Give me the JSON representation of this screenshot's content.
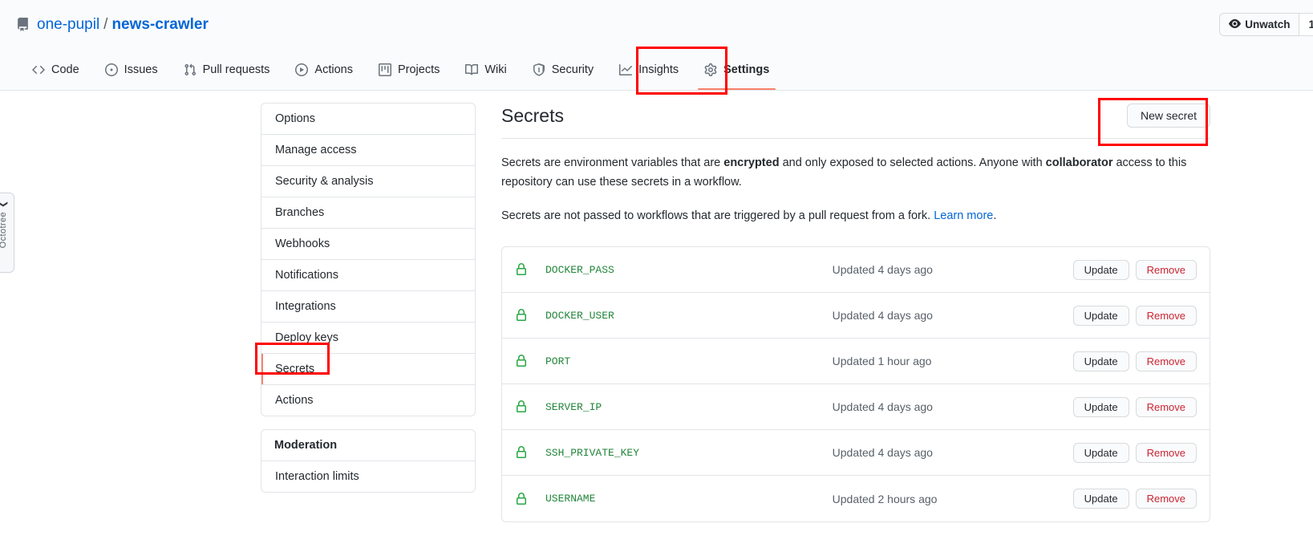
{
  "repo": {
    "owner": "one-pupil",
    "separator": "/",
    "name": "news-crawler",
    "watch_label": "Unwatch",
    "watch_count": "1"
  },
  "nav": {
    "tabs": [
      {
        "label": "Code",
        "icon": "code-icon",
        "active": false
      },
      {
        "label": "Issues",
        "icon": "issue-opened-icon",
        "active": false
      },
      {
        "label": "Pull requests",
        "icon": "git-pull-request-icon",
        "active": false
      },
      {
        "label": "Actions",
        "icon": "play-icon",
        "active": false
      },
      {
        "label": "Projects",
        "icon": "project-icon",
        "active": false
      },
      {
        "label": "Wiki",
        "icon": "book-icon",
        "active": false
      },
      {
        "label": "Security",
        "icon": "shield-icon",
        "active": false
      },
      {
        "label": "Insights",
        "icon": "graph-icon",
        "active": false
      },
      {
        "label": "Settings",
        "icon": "gear-icon",
        "active": true
      }
    ]
  },
  "octotree": {
    "label": "Octotree",
    "chevron": "❯"
  },
  "sidebar": {
    "items": [
      {
        "label": "Options",
        "selected": false
      },
      {
        "label": "Manage access",
        "selected": false
      },
      {
        "label": "Security & analysis",
        "selected": false
      },
      {
        "label": "Branches",
        "selected": false
      },
      {
        "label": "Webhooks",
        "selected": false
      },
      {
        "label": "Notifications",
        "selected": false
      },
      {
        "label": "Integrations",
        "selected": false
      },
      {
        "label": "Deploy keys",
        "selected": false
      },
      {
        "label": "Secrets",
        "selected": true
      },
      {
        "label": "Actions",
        "selected": false
      }
    ],
    "moderation_heading": "Moderation",
    "moderation_items": [
      {
        "label": "Interaction limits"
      }
    ]
  },
  "main": {
    "title": "Secrets",
    "new_secret_label": "New secret",
    "paragraph1": {
      "part1": "Secrets are environment variables that are ",
      "bold1": "encrypted",
      "part2": " and only exposed to selected actions. Anyone with ",
      "bold2": "collaborator",
      "part3": " access to this repository can use these secrets in a workflow."
    },
    "paragraph2": {
      "text": "Secrets are not passed to workflows that are triggered by a pull request from a fork. ",
      "link": "Learn more",
      "suffix": "."
    },
    "actions": {
      "update_label": "Update",
      "remove_label": "Remove"
    },
    "secrets": [
      {
        "name": "DOCKER_PASS",
        "updated": "Updated 4 days ago"
      },
      {
        "name": "DOCKER_USER",
        "updated": "Updated 4 days ago"
      },
      {
        "name": "PORT",
        "updated": "Updated 1 hour ago"
      },
      {
        "name": "SERVER_IP",
        "updated": "Updated 4 days ago"
      },
      {
        "name": "SSH_PRIVATE_KEY",
        "updated": "Updated 4 days ago"
      },
      {
        "name": "USERNAME",
        "updated": "Updated 2 hours ago"
      }
    ]
  },
  "annotations": {
    "color": "#ff0000",
    "boxes": [
      "settings-tab",
      "new-secret-button",
      "secrets-sidebar-item"
    ]
  }
}
